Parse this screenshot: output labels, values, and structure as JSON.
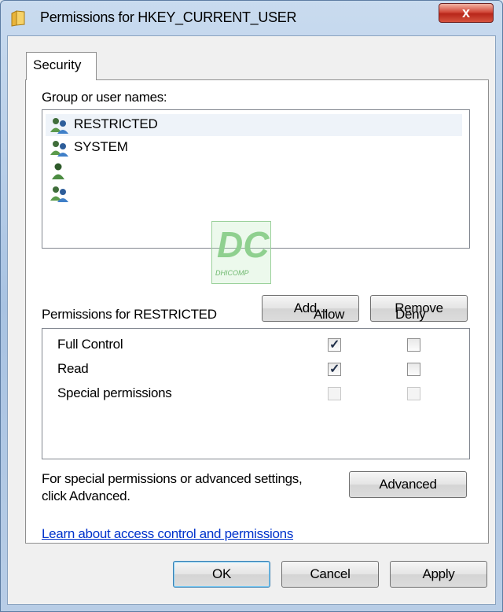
{
  "window": {
    "title": "Permissions for HKEY_CURRENT_USER",
    "close_label": "x"
  },
  "tabs": [
    {
      "label": "Security",
      "selected": true
    }
  ],
  "groups": {
    "label": "Group or user names:",
    "items": [
      {
        "name": "RESTRICTED",
        "icon": "user-group-icon",
        "selected": true
      },
      {
        "name": "SYSTEM",
        "icon": "user-group-icon",
        "selected": false
      },
      {
        "name": "",
        "icon": "user-icon",
        "selected": false
      },
      {
        "name": "",
        "icon": "user-group-icon",
        "selected": false
      }
    ],
    "add_label": "Add...",
    "remove_label": "Remove"
  },
  "permissions": {
    "label": "Permissions for RESTRICTED",
    "allow_header": "Allow",
    "deny_header": "Deny",
    "rows": [
      {
        "name": "Full Control",
        "allow": true,
        "deny": false,
        "enabled": true
      },
      {
        "name": "Read",
        "allow": true,
        "deny": false,
        "enabled": true
      },
      {
        "name": "Special permissions",
        "allow": false,
        "deny": false,
        "enabled": false
      }
    ]
  },
  "advanced": {
    "text_line1": "For special permissions or advanced settings,",
    "text_line2": "click Advanced.",
    "button_label": "Advanced"
  },
  "link_text": "Learn about access control and permissions",
  "footer": {
    "ok_label": "OK",
    "cancel_label": "Cancel",
    "apply_label": "Apply"
  },
  "watermark": {
    "letters": "DC",
    "text": "DHICOMP"
  }
}
